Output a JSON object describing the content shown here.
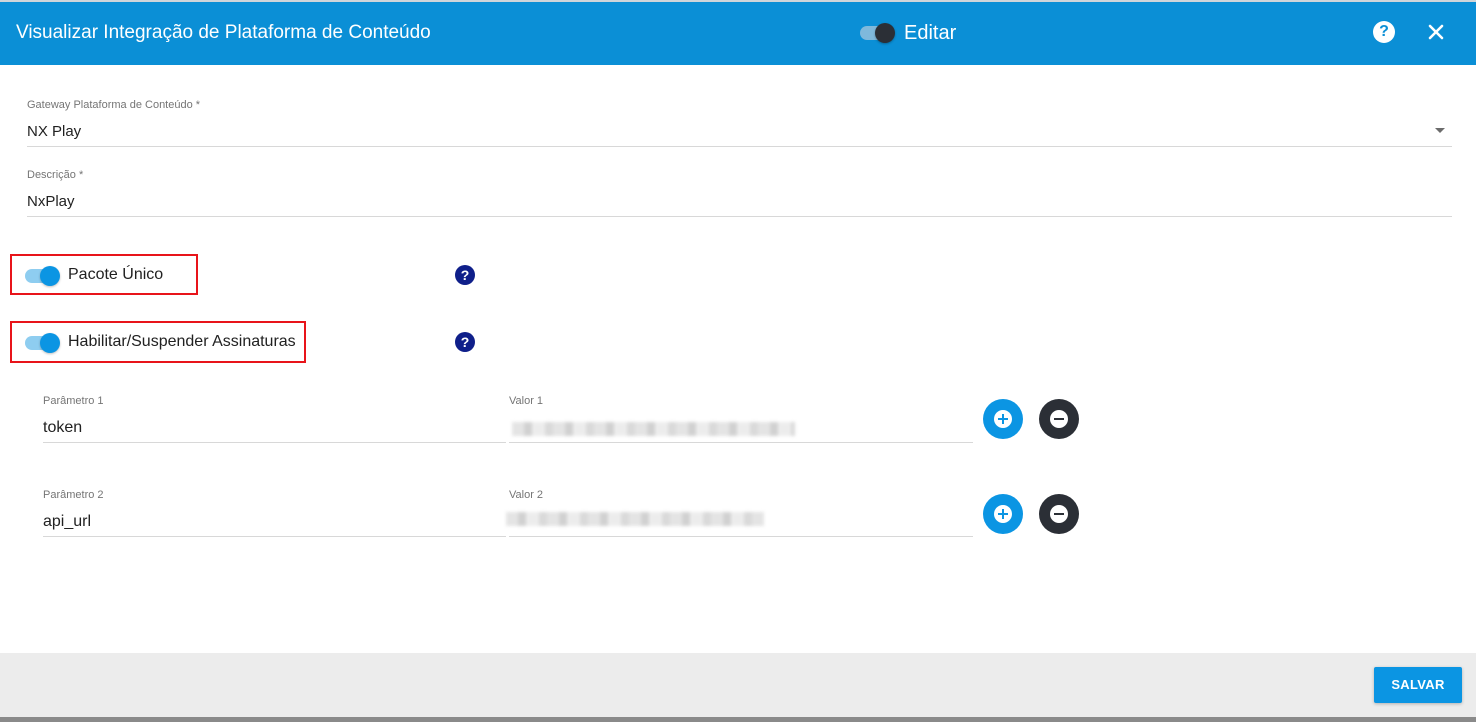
{
  "dialog": {
    "title": "Visualizar Integração de Plataforma de Conteúdo",
    "edit_label": "Editar",
    "edit_toggle_on": true,
    "help_icon": "help-circle-icon",
    "close_icon": "close-icon",
    "help_glyph": "?"
  },
  "form": {
    "gateway": {
      "label": "Gateway Plataforma de Conteúdo *",
      "value": "NX Play"
    },
    "descricao": {
      "label": "Descrição *",
      "value": "NxPlay"
    },
    "pacote_unico": {
      "label": "Pacote Único",
      "checked": true,
      "help_glyph": "?"
    },
    "habilitar": {
      "label": "Habilitar/Suspender Assinaturas",
      "checked": true,
      "help_glyph": "?"
    }
  },
  "parameters": [
    {
      "param_label": "Parâmetro 1",
      "param_value": "token",
      "value_label": "Valor 1",
      "value_redacted": true
    },
    {
      "param_label": "Parâmetro 2",
      "param_value": "api_url",
      "value_label": "Valor 2",
      "value_redacted": true
    }
  ],
  "footer": {
    "save_label": "SALVAR"
  },
  "colors": {
    "header": "#0b8fd6",
    "accent": "#0b95e3",
    "dark": "#2b2f36",
    "highlight": "#e8141a"
  }
}
